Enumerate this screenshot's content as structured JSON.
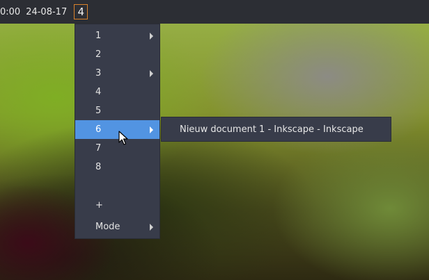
{
  "topbar": {
    "clock": "0:00",
    "date": "24-08-17",
    "workspace": "4"
  },
  "menu": {
    "items": [
      {
        "label": "1",
        "has_submenu": true
      },
      {
        "label": "2",
        "has_submenu": false
      },
      {
        "label": "3",
        "has_submenu": true
      },
      {
        "label": "4",
        "has_submenu": false
      },
      {
        "label": "5",
        "has_submenu": false
      },
      {
        "label": "6",
        "has_submenu": true,
        "active": true
      },
      {
        "label": "7",
        "has_submenu": false
      },
      {
        "label": "8",
        "has_submenu": false
      },
      {
        "label": "+",
        "has_submenu": false
      },
      {
        "label": "Mode",
        "has_submenu": true
      }
    ]
  },
  "submenu": {
    "window_title": "Nieuw document 1 - Inkscape - Inkscape"
  },
  "colors": {
    "accent": "#5294e2",
    "workspace_border": "#d9822b",
    "menu_bg": "#383c4a",
    "panel_bg": "#2c2e34"
  },
  "icons": {
    "submenu_arrow": "triangle-right-icon",
    "pointer": "mouse-pointer-icon"
  }
}
